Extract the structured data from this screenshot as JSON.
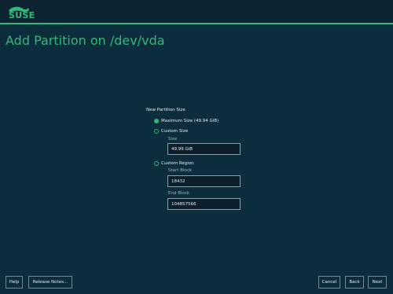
{
  "header": {
    "logo_text": "SUSE"
  },
  "page": {
    "title": "Add Partition on /dev/vda"
  },
  "form": {
    "section_label": "New Partition Size",
    "options": [
      {
        "label": "Maximum Size (49.94 GiB)",
        "checked": true
      },
      {
        "label": "Custom Size",
        "checked": false
      },
      {
        "label": "Custom Region",
        "checked": false
      }
    ],
    "size": {
      "label": "Size",
      "value": "49.99 GiB"
    },
    "start_block": {
      "label": "Start Block",
      "value": "18432"
    },
    "end_block": {
      "label": "End Block",
      "value": "104857566"
    }
  },
  "footer": {
    "help": "Help",
    "release_notes": "Release Notes...",
    "cancel": "Cancel",
    "back": "Back",
    "next": "Next"
  },
  "colors": {
    "background": "#0b2d3c",
    "accent": "#30ba78",
    "topbar": "#0c2431"
  }
}
